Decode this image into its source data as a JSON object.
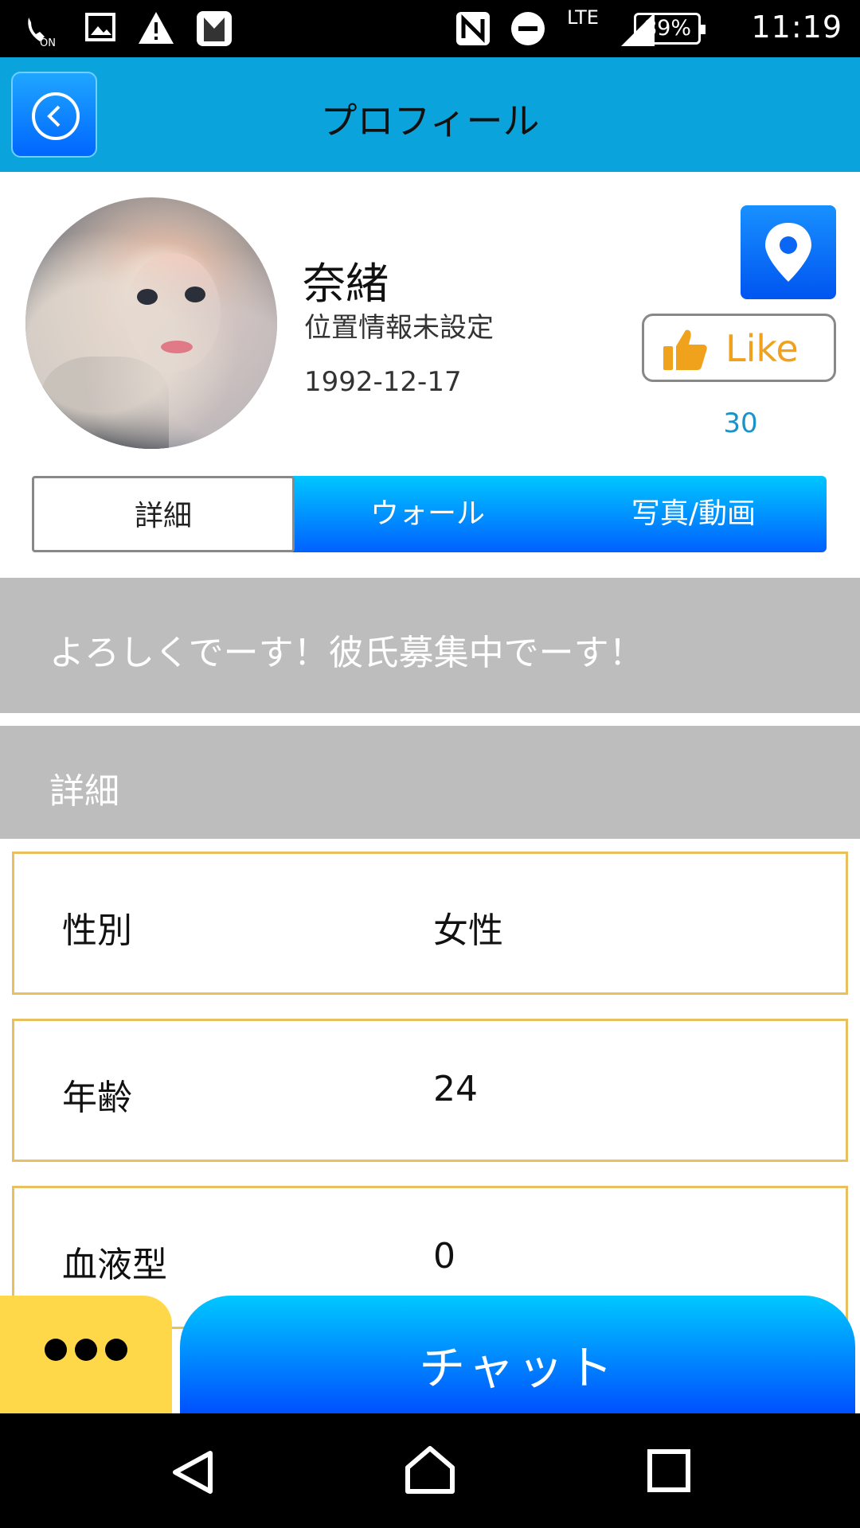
{
  "status_bar": {
    "battery": "89%",
    "network": "LTE",
    "time": "11:19"
  },
  "header": {
    "title": "プロフィール"
  },
  "profile": {
    "name": "奈緒",
    "location": "位置情報未設定",
    "birthdate": "1992-12-17",
    "like_label": "Like",
    "like_count": "30"
  },
  "tabs": [
    {
      "label": "詳細"
    },
    {
      "label": "ウォール"
    },
    {
      "label": "写真/動画"
    }
  ],
  "bio": "よろしくでーす！彼氏募集中でーす！",
  "details": {
    "title": "詳細",
    "rows": [
      {
        "label": "性別",
        "value": "女性"
      },
      {
        "label": "年齢",
        "value": "24"
      },
      {
        "label": "血液型",
        "value": "0"
      }
    ]
  },
  "footer": {
    "chat_label": "チャット"
  },
  "colors": {
    "header": "#0aa3db",
    "accent_blue": "#0060ff",
    "like_orange": "#f0a21d",
    "gray_banner": "#bdbdbd",
    "row_border": "#e9c060",
    "more_yellow": "#ffd84a"
  },
  "icons": {
    "back": "chevron-left-circle-icon",
    "location": "map-pin-icon",
    "like": "thumbs-up-icon",
    "more": "ellipsis-icon",
    "nav_back": "triangle-back-icon",
    "nav_home": "home-icon",
    "nav_recents": "square-recents-icon"
  }
}
